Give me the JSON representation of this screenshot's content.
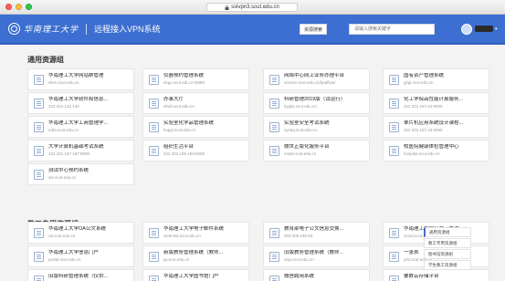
{
  "browser": {
    "url": "sslvpn3.scut.edu.cn"
  },
  "header": {
    "university_name": "华南理工大学",
    "system_name": "远程接入VPN系统",
    "search_button": "资源搜索",
    "search_placeholder": "请输入搜索关键字"
  },
  "sections": [
    {
      "title": "通用资源组",
      "cards": [
        {
          "title": "华南理工大学网站群管理",
          "url": "sites.scut.edu.cn"
        },
        {
          "title": "仪器预约管理系统",
          "url": "dzgx.scut.edu.cn:8080"
        },
        {
          "title": "网络中心网上业务办理平台",
          "url": "service.scut.edu.cn/bpaflow/"
        },
        {
          "title": "国有资产管理系统",
          "url": "gzgl.scut.edu.cn"
        },
        {
          "title": "华南理工大学软件和信息...",
          "url": "222.201.132.130"
        },
        {
          "title": "办事大厅",
          "url": "ehall.scut.edu.cn"
        },
        {
          "title": "科研管理2019版（试运行）",
          "url": "kyglxt.scut.edu.cn"
        },
        {
          "title": "化工学院高性能计算服务...",
          "url": "222.201.187.84:8000"
        },
        {
          "title": "华南理工大学工商管理学...",
          "url": "mba.scut.edu.cn"
        },
        {
          "title": "实验室化学品管理系统",
          "url": "hxpgl.scut.edu.cn"
        },
        {
          "title": "实验室安全考试系统",
          "url": "sysaq.scut.edu.cn"
        },
        {
          "title": "单片机应用系统设计课程...",
          "url": "222.201.187.18:8080"
        },
        {
          "title": "大学计算机基础考试系统",
          "url": "222.201.187.187:8080"
        },
        {
          "title": "组织生活平台",
          "url": "222.201.186.150:8000"
        },
        {
          "title": "微世正版化服务平台",
          "url": "msdn.scut.edu.cn"
        },
        {
          "title": "校医院健康体检管理中心",
          "url": "hospital.scut.edu.cn"
        },
        {
          "title": "测试中心预约系统",
          "url": "atc.scut.edu.cn"
        }
      ]
    },
    {
      "title": "教工专用资源组",
      "cards": [
        {
          "title": "华南理工大学OA公文系统",
          "url": "oa.scut.edu.cn"
        },
        {
          "title": "华南理工大学电子邮件系统",
          "url": "webmail.scut.edu.cn"
        },
        {
          "title": "教育部电子公文信息交换...",
          "url": "202.205.180.63"
        },
        {
          "title": "华南理工大学公共云管理",
          "url": "cloud.scut.edu.cn"
        },
        {
          "title": "华南理工大学信息门户",
          "url": "portal.scut.edu.cn"
        },
        {
          "title": "新版教务管理系统（教师...",
          "url": "jw.scut.edu.cn"
        },
        {
          "title": "旧版教务管理系统（教师...",
          "url": "xsjw.scut.edu.cn"
        },
        {
          "title": "一张表",
          "url": "yzb.scut.edu.cn"
        },
        {
          "title": "旧版科研管理系统（仅供...",
          "url": "kygl.scut.edu.cn"
        },
        {
          "title": "华南理工大学图书馆门户",
          "url": "222.201.19.33"
        },
        {
          "title": "微信聘用系统",
          "url": "hr.scut.edu.cn"
        },
        {
          "title": "要数云存储平台",
          "url": "cloud.scut.edu.cn"
        }
      ]
    }
  ],
  "float_menu": [
    "通用资源组",
    "教工专用资源组",
    "图书馆资源组",
    "学生教工资源组"
  ]
}
